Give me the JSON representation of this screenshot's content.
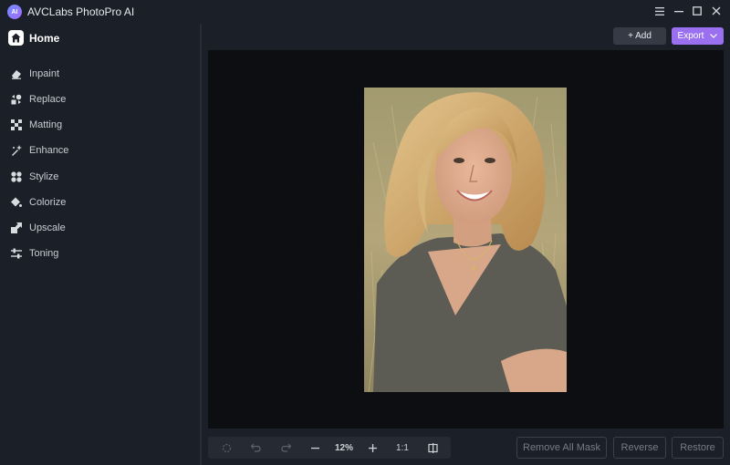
{
  "app": {
    "title": "AVCLabs PhotoPro AI",
    "logo_text": "AI"
  },
  "window_controls": [
    "menu-icon",
    "minimize-icon",
    "maximize-icon",
    "close-icon"
  ],
  "sidebar": {
    "home_label": "Home",
    "items": [
      {
        "label": "Inpaint",
        "icon": "eraser-icon"
      },
      {
        "label": "Replace",
        "icon": "replace-icon"
      },
      {
        "label": "Matting",
        "icon": "matting-icon"
      },
      {
        "label": "Enhance",
        "icon": "enhance-icon"
      },
      {
        "label": "Stylize",
        "icon": "stylize-icon"
      },
      {
        "label": "Colorize",
        "icon": "colorize-icon"
      },
      {
        "label": "Upscale",
        "icon": "upscale-icon"
      },
      {
        "label": "Toning",
        "icon": "toning-icon"
      }
    ]
  },
  "header": {
    "add_label": "+ Add",
    "export_label": "Export"
  },
  "toolbar": {
    "zoom": "12%",
    "ratio_label": "1:1"
  },
  "actions": {
    "remove_all_mask": "Remove All Mask",
    "reverse": "Reverse",
    "restore": "Restore"
  },
  "colors": {
    "accent": "#9b70f0",
    "background": "#1b1f27",
    "canvas": "#0c0e12"
  }
}
